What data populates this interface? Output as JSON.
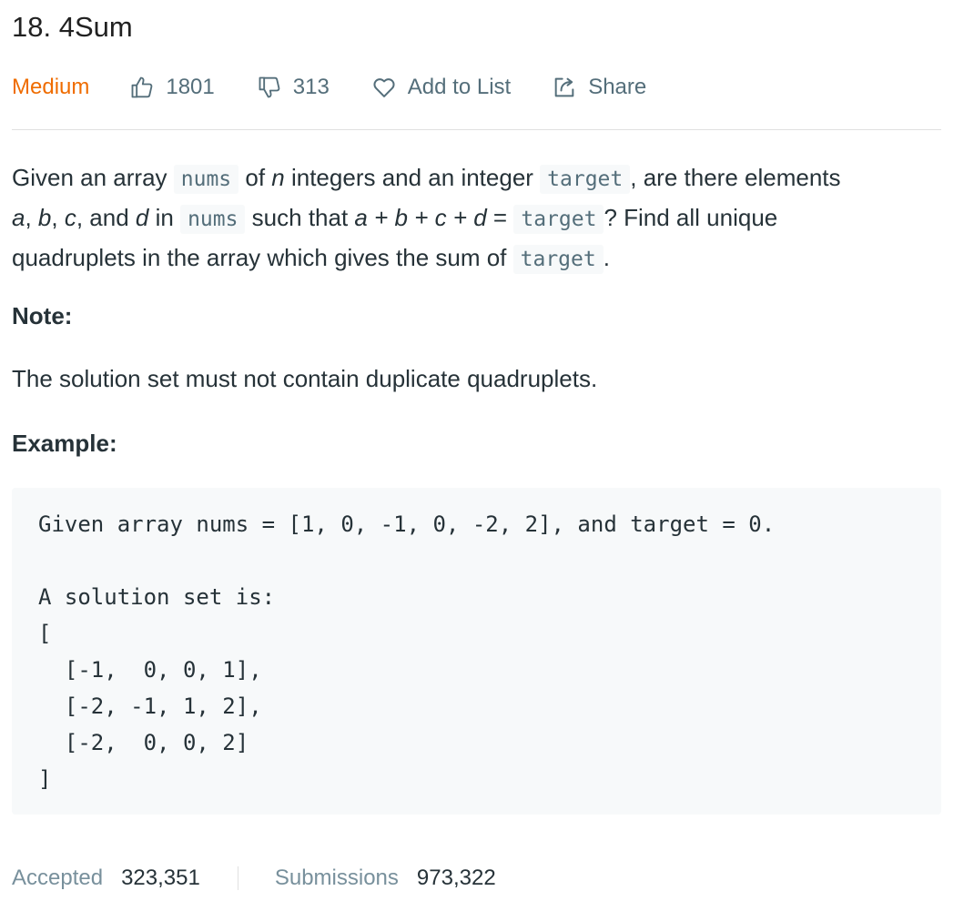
{
  "problem": {
    "title": "18. 4Sum",
    "difficulty": "Medium",
    "likes": "1801",
    "dislikes": "313",
    "add_to_list": "Add to List",
    "share": "Share"
  },
  "icons": {
    "like": "thumbs-up-icon",
    "dislike": "thumbs-down-icon",
    "list": "heart-icon",
    "share": "share-icon"
  },
  "colors": {
    "difficulty_medium": "#ef6c00",
    "meta_gray": "#546e7a",
    "code_bg": "#f7f9fa"
  },
  "description": {
    "l1_a": "Given an array ",
    "l1_code1": "nums",
    "l1_b": " of ",
    "l1_n": "n",
    "l1_c": " integers and an integer ",
    "l1_code2": "target",
    "l1_d": ", are there elements",
    "l2_a": "a",
    "l2_sep1": ", ",
    "l2_b": "b",
    "l2_sep2": ", ",
    "l2_c": "c",
    "l2_and": ", and ",
    "l2_d": "d",
    "l2_in": " in ",
    "l2_code1": "nums",
    "l2_such": " such that ",
    "l2_expr": "a + b + c + d",
    "l2_eq": " = ",
    "l2_code2": "target",
    "l2_end": "? Find all unique",
    "l3_a": "quadruplets in the array which gives the sum of ",
    "l3_code": "target",
    "l3_end": "."
  },
  "note": {
    "heading": "Note:",
    "text": "The solution set must not contain duplicate quadruplets."
  },
  "example": {
    "heading": "Example:",
    "code": "Given array nums = [1, 0, -1, 0, -2, 2], and target = 0.\n\nA solution set is:\n[\n  [-1,  0, 0, 1],\n  [-2, -1, 1, 2],\n  [-2,  0, 0, 2]\n]"
  },
  "stats": {
    "accepted_label": "Accepted",
    "accepted_value": "323,351",
    "submissions_label": "Submissions",
    "submissions_value": "973,322"
  }
}
